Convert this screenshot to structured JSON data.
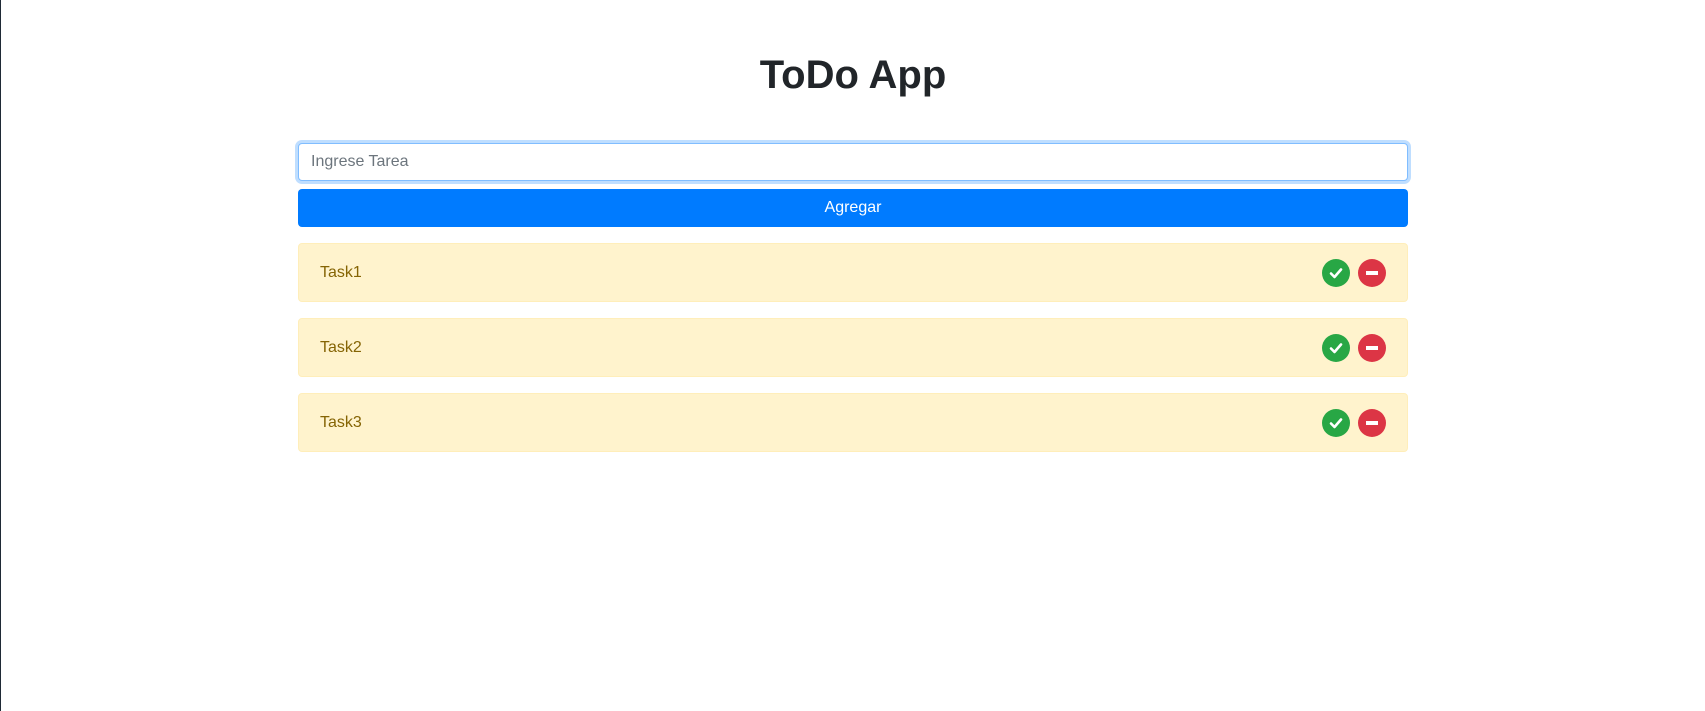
{
  "app": {
    "title": "ToDo App"
  },
  "form": {
    "input_value": "",
    "input_placeholder": "Ingrese Tarea",
    "add_label": "Agregar"
  },
  "tasks": [
    {
      "label": "Task1",
      "complete_icon": "check-circle-icon",
      "delete_icon": "minus-circle-icon"
    },
    {
      "label": "Task2",
      "complete_icon": "check-circle-icon",
      "delete_icon": "minus-circle-icon"
    },
    {
      "label": "Task3",
      "complete_icon": "check-circle-icon",
      "delete_icon": "minus-circle-icon"
    }
  ],
  "colors": {
    "primary": "#007bff",
    "success": "#28a745",
    "danger": "#dc3545",
    "warning_bg": "#fff3cd",
    "warning_text": "#856404",
    "title_text": "#212529"
  }
}
